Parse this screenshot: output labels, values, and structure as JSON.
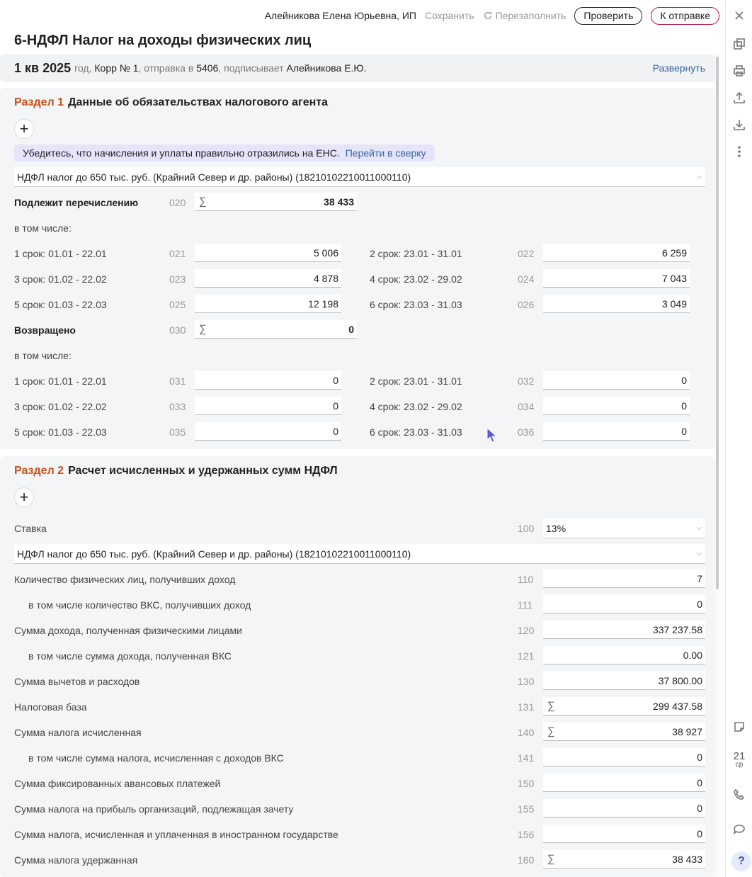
{
  "topbar": {
    "user": "Алейникова Елена Юрьевна, ИП",
    "save": "Сохранить",
    "refill": "Перезаполнить",
    "check": "Проверить",
    "send": "К отправке"
  },
  "title": "6-НДФЛ Налог на доходы физических лиц",
  "period": {
    "quarter": "1 кв 2025",
    "year_word": "год,",
    "corr_prefix": "Корр №",
    "corr_num": "1",
    "send_prefix": ", отправка в",
    "ifns": "5406",
    "sign_prefix": ", подписывает",
    "signer": "Алейникова Е.Ю.",
    "expand": "Развернуть"
  },
  "section1": {
    "num": "Раздел 1",
    "title": "Данные об обязательствах налогового агента",
    "notice": "Убедитесь, что начисления и уплаты правильно отразились на ЕНС.",
    "notice_link": "Перейти в сверку",
    "kbk": "НДФЛ налог до 650 тыс. руб. (Крайний Север и др. районы) (18210102210011000110)",
    "due": {
      "label": "Подлежит перечислению",
      "code": "020",
      "value": "38 433"
    },
    "incl1": "в том числе:",
    "terms1": [
      {
        "label": "1 срок: 01.01 - 22.01",
        "code": "021",
        "value": "5 006"
      },
      {
        "label": "2 срок: 23.01 - 31.01",
        "code": "022",
        "value": "6 259"
      },
      {
        "label": "3 срок: 01.02 - 22.02",
        "code": "023",
        "value": "4 878"
      },
      {
        "label": "4 срок: 23.02 - 29.02",
        "code": "024",
        "value": "7 043"
      },
      {
        "label": "5 срок: 01.03 - 22.03",
        "code": "025",
        "value": "12 198"
      },
      {
        "label": "6 срок: 23.03 - 31.03",
        "code": "026",
        "value": "3 049"
      }
    ],
    "returned": {
      "label": "Возвращено",
      "code": "030",
      "value": "0"
    },
    "incl2": "в том числе:",
    "terms2": [
      {
        "label": "1 срок: 01.01 - 22.01",
        "code": "031",
        "value": "0"
      },
      {
        "label": "2 срок: 23.01 - 31.01",
        "code": "032",
        "value": "0"
      },
      {
        "label": "3 срок: 01.02 - 22.02",
        "code": "033",
        "value": "0"
      },
      {
        "label": "4 срок: 23.02 - 29.02",
        "code": "034",
        "value": "0"
      },
      {
        "label": "5 срок: 01.03 - 22.03",
        "code": "035",
        "value": "0"
      },
      {
        "label": "6 срок: 23.03 - 31.03",
        "code": "036",
        "value": "0"
      }
    ]
  },
  "section2": {
    "num": "Раздел 2",
    "title": "Расчет исчисленных и удержанных сумм НДФЛ",
    "rate": {
      "label": "Ставка",
      "code": "100",
      "value": "13%"
    },
    "kbk": "НДФЛ налог до 650 тыс. руб. (Крайний Север и др. районы) (18210102210011000110)",
    "rows": [
      {
        "label": "Количество физических лиц, получивших доход",
        "code": "110",
        "value": "7"
      },
      {
        "label": "в том числе количество ВКС, получивших доход",
        "code": "111",
        "value": "0"
      },
      {
        "label": "Сумма дохода, полученная физическими лицами",
        "code": "120",
        "value": "337 237.58"
      },
      {
        "label": "в том числе сумма дохода, полученная ВКС",
        "code": "121",
        "value": "0.00"
      },
      {
        "label": "Сумма вычетов и расходов",
        "code": "130",
        "value": "37 800.00"
      },
      {
        "label": "Налоговая база",
        "code": "131",
        "value": "299 437.58"
      },
      {
        "label": "Сумма налога исчисленная",
        "code": "140",
        "value": "38 927"
      },
      {
        "label": "в том числе сумма налога, исчисленная с доходов ВКС",
        "code": "141",
        "value": "0"
      },
      {
        "label": "Сумма фиксированных авансовых платежей",
        "code": "150",
        "value": "0"
      },
      {
        "label": "Сумма налога на прибыль организаций, подлежащая зачету",
        "code": "155",
        "value": "0"
      },
      {
        "label": "Сумма налога, исчисленная и уплаченная в иностранном государстве",
        "code": "156",
        "value": "0"
      },
      {
        "label": "Сумма налога удержанная",
        "code": "160",
        "value": "38 433"
      }
    ]
  },
  "rail": {
    "day": "21",
    "weekday": "ср",
    "help": "?"
  },
  "sigma": "∑"
}
